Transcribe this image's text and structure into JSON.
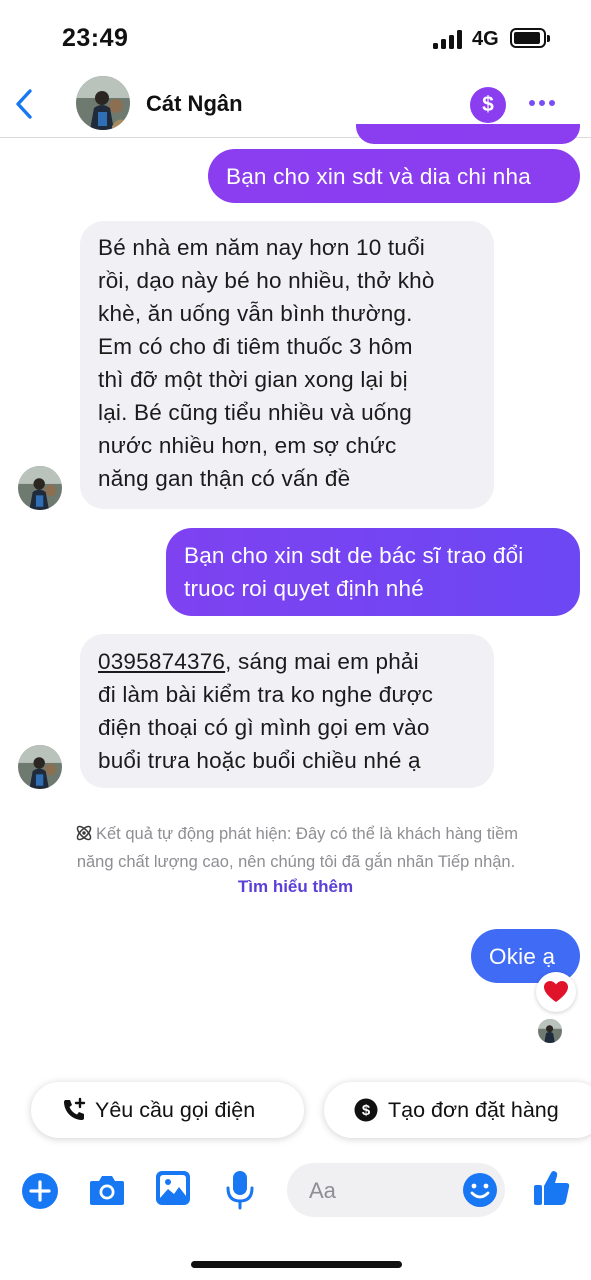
{
  "status_bar": {
    "time": "23:49",
    "network": "4G"
  },
  "header": {
    "contact_name": "Cát Ngân",
    "money_symbol": "$"
  },
  "messages": [
    {
      "direction": "outgoing",
      "text": "Bạn cho xin sdt và dia chi nha"
    },
    {
      "direction": "incoming",
      "lines": [
        "Bé nhà em năm nay hơn 10 tuổi",
        "rồi, dạo này bé ho nhiều, thở khò",
        "khè, ăn uống vẫn bình thường.",
        "Em có cho đi tiêm thuốc 3 hôm",
        "thì đỡ một thời gian xong lại bị",
        "lại. Bé cũng tiểu nhiều và uống",
        "nước nhiều hơn, em sợ chức",
        "năng gan thận có vấn đề"
      ]
    },
    {
      "direction": "outgoing",
      "lines": [
        "Bạn cho xin sdt de bác sĩ trao đổi",
        "truoc roi quyet định nhé"
      ]
    },
    {
      "direction": "incoming",
      "phone": "0395874376",
      "lines": [
        ", sáng mai em phải",
        "đi làm bài kiểm tra ko nghe được",
        "điện thoại có gì mình gọi em vào",
        "buổi trưa hoặc buổi chiều nhé ạ"
      ]
    },
    {
      "direction": "outgoing",
      "text": "Okie ạ",
      "reaction": "heart"
    }
  ],
  "auto_detect_notice": {
    "line1": "Kết quả tự động phát hiện: Đây có thể là khách hàng tiềm",
    "line2": "năng chất lượng cao, nên chúng tôi đã gắn nhãn Tiếp nhận.",
    "link": "Tìm hiểu thêm"
  },
  "quick_actions": [
    {
      "label": "Yêu cầu gọi điện",
      "icon": "phone-plus-icon"
    },
    {
      "label": "Tạo đơn đặt hàng",
      "icon": "dollar-circle-icon"
    }
  ],
  "composer": {
    "placeholder": "Aa"
  },
  "colors": {
    "outgoing_gradient_start": "#8b3df0",
    "outgoing_gradient_end": "#3f6bf5",
    "incoming_bg": "#f0f0f5",
    "accent_blue": "#1877f2",
    "accent_purple": "#8a3ef0"
  }
}
